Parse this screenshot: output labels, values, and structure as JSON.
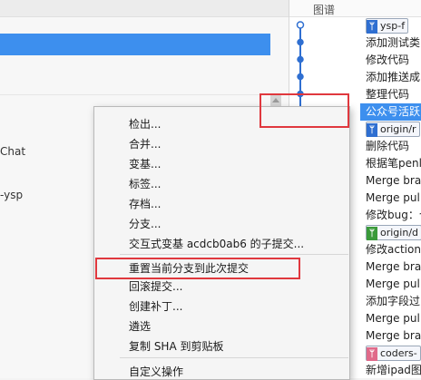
{
  "left_pane": {
    "fragment_chat": "Chat",
    "fragment_ysp": "-ysp"
  },
  "graph_pane": {
    "header": "图谱",
    "commits": [
      {
        "message": "ysp-f",
        "tag": {
          "style": "blue",
          "icon": "branch-icon",
          "head": true
        }
      },
      {
        "message": "添加测试类"
      },
      {
        "message": "修改代码"
      },
      {
        "message": "添加推送成"
      },
      {
        "message": "整理代码"
      },
      {
        "message": "公众号活跃",
        "selected": true
      },
      {
        "message": "origin/r",
        "tag": {
          "style": "blue",
          "icon": "branch-icon"
        }
      },
      {
        "message": "删除代码"
      },
      {
        "message": "根据笔penl"
      },
      {
        "message": "Merge bra"
      },
      {
        "message": "Merge pul"
      },
      {
        "message": "修改bug：个"
      },
      {
        "message": "origin/d",
        "tag": {
          "style": "green",
          "icon": "branch-icon"
        }
      },
      {
        "message": "修改action"
      },
      {
        "message": "Merge bra"
      },
      {
        "message": "Merge pul"
      },
      {
        "message": "添加字段过"
      },
      {
        "message": "Merge pul"
      },
      {
        "message": "Merge bra"
      },
      {
        "message": "coders-",
        "tag": {
          "style": "pink",
          "icon": "branch-icon"
        }
      },
      {
        "message": "新增ipad图"
      }
    ],
    "colors": {
      "line": "#2f6fd1",
      "selected": "#3d8fee"
    }
  },
  "context_menu": {
    "items": [
      {
        "label": "检出..."
      },
      {
        "label": "合并..."
      },
      {
        "label": "变基..."
      },
      {
        "label": "标签..."
      },
      {
        "label": "存档..."
      },
      {
        "label": "分支..."
      },
      {
        "label": "交互式变基 acdcb0ab6 的子提交..."
      },
      {
        "label": "重置当前分支到此次提交",
        "annotated": true
      },
      {
        "label": "回滚提交..."
      },
      {
        "label": "创建补丁..."
      },
      {
        "label": "遴选"
      },
      {
        "label": "复制 SHA 到剪贴板"
      },
      {
        "label": "自定义操作"
      }
    ]
  }
}
